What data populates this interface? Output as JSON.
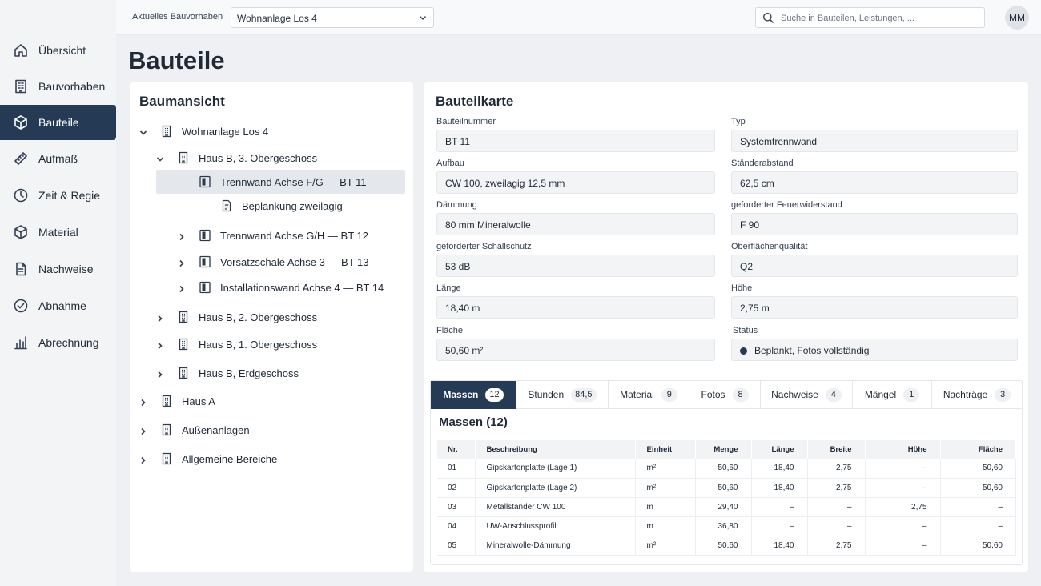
{
  "nav": {
    "items": [
      {
        "label": "Übersicht",
        "icon": "home-icon"
      },
      {
        "label": "Bauvorhaben",
        "icon": "building-icon"
      },
      {
        "label": "Bauteile",
        "icon": "cube-icon",
        "active": true
      },
      {
        "label": "Aufmaß",
        "icon": "ruler-icon"
      },
      {
        "label": "Zeit & Regie",
        "icon": "clock-icon"
      },
      {
        "label": "Material",
        "icon": "box-icon"
      },
      {
        "label": "Nachweise",
        "icon": "document-icon"
      },
      {
        "label": "Abnahme",
        "icon": "check-circle-icon"
      },
      {
        "label": "Abrechnung",
        "icon": "bar-chart-icon"
      }
    ]
  },
  "header": {
    "project_label": "Aktuelles Bauvorhaben",
    "project_value": "Wohnanlage Los 4",
    "search_placeholder": "Suche in Bauteilen, Leistungen, ...",
    "avatar_initials": "MM"
  },
  "page_title": "Bauteile",
  "tree": {
    "title": "Baumansicht",
    "items": [
      {
        "label": "Wohnanlage Los 4",
        "level": 0,
        "expanded": true,
        "icon": "building-icon"
      },
      {
        "label": "Haus B, 3. Obergeschoss",
        "level": 1,
        "expanded": true,
        "icon": "building-icon"
      },
      {
        "label": "Trennwand Achse F/G — BT 11",
        "level": 2,
        "selected": true,
        "icon": "wall-icon"
      },
      {
        "label": "Beplankung zweilagig",
        "level": 3,
        "icon": "document-icon"
      },
      {
        "label": "Trennwand Achse G/H — BT 12",
        "level": 2,
        "expanded": false,
        "icon": "wall-icon"
      },
      {
        "label": "Vorsatzschale Achse 3 — BT 13",
        "level": 2,
        "expanded": false,
        "icon": "wall-icon"
      },
      {
        "label": "Installationswand Achse 4 — BT 14",
        "level": 2,
        "expanded": false,
        "icon": "wall-icon"
      },
      {
        "label": "Haus B, 2. Obergeschoss",
        "level": 1,
        "expanded": false,
        "icon": "building-icon"
      },
      {
        "label": "Haus B, 1. Obergeschoss",
        "level": 1,
        "expanded": false,
        "icon": "building-icon"
      },
      {
        "label": "Haus B, Erdgeschoss",
        "level": 1,
        "expanded": false,
        "icon": "building-icon"
      },
      {
        "label": "Haus A",
        "level": 0,
        "expanded": false,
        "icon": "building-icon"
      },
      {
        "label": "Außenanlagen",
        "level": 0,
        "expanded": false,
        "icon": "building-icon"
      },
      {
        "label": "Allgemeine Bereiche",
        "level": 0,
        "expanded": false,
        "icon": "building-icon"
      }
    ]
  },
  "card": {
    "title": "Bauteilkarte",
    "fields": [
      {
        "label": "Bauteilnummer",
        "value": "BT 11"
      },
      {
        "label": "Typ",
        "value": "Systemtrennwand"
      },
      {
        "label": "Aufbau",
        "value": "CW 100, zweilagig 12,5 mm"
      },
      {
        "label": "Ständerabstand",
        "value": "62,5 cm"
      },
      {
        "label": "Dämmung",
        "value": "80 mm Mineralwolle"
      },
      {
        "label": "geforderter Feuerwiderstand",
        "value": "F 90"
      },
      {
        "label": "geforderter Schallschutz",
        "value": "53 dB"
      },
      {
        "label": "Oberflächenqualität",
        "value": "Q2"
      },
      {
        "label": "Länge",
        "value": "18,40 m"
      },
      {
        "label": "Höhe",
        "value": "2,75 m"
      },
      {
        "label": "Fläche",
        "value": "50,60 m²"
      },
      {
        "label": "Status",
        "value": "Beplankt, Fotos vollständig",
        "status_color": "#253b55"
      }
    ]
  },
  "tabs": [
    {
      "label": "Massen",
      "count": "12",
      "active": true
    },
    {
      "label": "Stunden",
      "count": "84,5"
    },
    {
      "label": "Material",
      "count": "9"
    },
    {
      "label": "Fotos",
      "count": "8"
    },
    {
      "label": "Nachweise",
      "count": "4"
    },
    {
      "label": "Mängel",
      "count": "1"
    },
    {
      "label": "Nachträge",
      "count": "3"
    }
  ],
  "massen": {
    "title": "Massen (12)",
    "columns": [
      "Nr.",
      "Beschreibung",
      "Einheit",
      "Menge",
      "Länge",
      "Breite",
      "Höhe",
      "Fläche"
    ],
    "rows": [
      [
        "01",
        "Gipskartonplatte (Lage 1)",
        "m²",
        "50,60",
        "18,40",
        "2,75",
        "–",
        "50,60"
      ],
      [
        "02",
        "Gipskartonplatte (Lage 2)",
        "m²",
        "50,60",
        "18,40",
        "2,75",
        "–",
        "50,60"
      ],
      [
        "03",
        "Metallständer CW 100",
        "m",
        "29,40",
        "–",
        "–",
        "2,75",
        "–"
      ],
      [
        "04",
        "UW-Anschlussprofil",
        "m",
        "36,80",
        "–",
        "–",
        "–",
        "–"
      ],
      [
        "05",
        "Mineralwolle-Dämmung",
        "m²",
        "50,60",
        "18,40",
        "2,75",
        "–",
        "50,60"
      ]
    ]
  },
  "colors": {
    "accent": "#253b55",
    "background": "#eef0f3"
  }
}
